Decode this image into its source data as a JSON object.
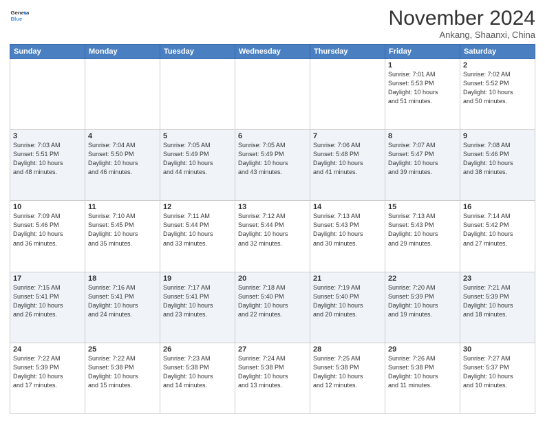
{
  "header": {
    "logo_line1": "General",
    "logo_line2": "Blue",
    "month": "November 2024",
    "location": "Ankang, Shaanxi, China"
  },
  "weekdays": [
    "Sunday",
    "Monday",
    "Tuesday",
    "Wednesday",
    "Thursday",
    "Friday",
    "Saturday"
  ],
  "weeks": [
    [
      {
        "day": "",
        "info": ""
      },
      {
        "day": "",
        "info": ""
      },
      {
        "day": "",
        "info": ""
      },
      {
        "day": "",
        "info": ""
      },
      {
        "day": "",
        "info": ""
      },
      {
        "day": "1",
        "info": "Sunrise: 7:01 AM\nSunset: 5:53 PM\nDaylight: 10 hours\nand 51 minutes."
      },
      {
        "day": "2",
        "info": "Sunrise: 7:02 AM\nSunset: 5:52 PM\nDaylight: 10 hours\nand 50 minutes."
      }
    ],
    [
      {
        "day": "3",
        "info": "Sunrise: 7:03 AM\nSunset: 5:51 PM\nDaylight: 10 hours\nand 48 minutes."
      },
      {
        "day": "4",
        "info": "Sunrise: 7:04 AM\nSunset: 5:50 PM\nDaylight: 10 hours\nand 46 minutes."
      },
      {
        "day": "5",
        "info": "Sunrise: 7:05 AM\nSunset: 5:49 PM\nDaylight: 10 hours\nand 44 minutes."
      },
      {
        "day": "6",
        "info": "Sunrise: 7:05 AM\nSunset: 5:49 PM\nDaylight: 10 hours\nand 43 minutes."
      },
      {
        "day": "7",
        "info": "Sunrise: 7:06 AM\nSunset: 5:48 PM\nDaylight: 10 hours\nand 41 minutes."
      },
      {
        "day": "8",
        "info": "Sunrise: 7:07 AM\nSunset: 5:47 PM\nDaylight: 10 hours\nand 39 minutes."
      },
      {
        "day": "9",
        "info": "Sunrise: 7:08 AM\nSunset: 5:46 PM\nDaylight: 10 hours\nand 38 minutes."
      }
    ],
    [
      {
        "day": "10",
        "info": "Sunrise: 7:09 AM\nSunset: 5:46 PM\nDaylight: 10 hours\nand 36 minutes."
      },
      {
        "day": "11",
        "info": "Sunrise: 7:10 AM\nSunset: 5:45 PM\nDaylight: 10 hours\nand 35 minutes."
      },
      {
        "day": "12",
        "info": "Sunrise: 7:11 AM\nSunset: 5:44 PM\nDaylight: 10 hours\nand 33 minutes."
      },
      {
        "day": "13",
        "info": "Sunrise: 7:12 AM\nSunset: 5:44 PM\nDaylight: 10 hours\nand 32 minutes."
      },
      {
        "day": "14",
        "info": "Sunrise: 7:13 AM\nSunset: 5:43 PM\nDaylight: 10 hours\nand 30 minutes."
      },
      {
        "day": "15",
        "info": "Sunrise: 7:13 AM\nSunset: 5:43 PM\nDaylight: 10 hours\nand 29 minutes."
      },
      {
        "day": "16",
        "info": "Sunrise: 7:14 AM\nSunset: 5:42 PM\nDaylight: 10 hours\nand 27 minutes."
      }
    ],
    [
      {
        "day": "17",
        "info": "Sunrise: 7:15 AM\nSunset: 5:41 PM\nDaylight: 10 hours\nand 26 minutes."
      },
      {
        "day": "18",
        "info": "Sunrise: 7:16 AM\nSunset: 5:41 PM\nDaylight: 10 hours\nand 24 minutes."
      },
      {
        "day": "19",
        "info": "Sunrise: 7:17 AM\nSunset: 5:41 PM\nDaylight: 10 hours\nand 23 minutes."
      },
      {
        "day": "20",
        "info": "Sunrise: 7:18 AM\nSunset: 5:40 PM\nDaylight: 10 hours\nand 22 minutes."
      },
      {
        "day": "21",
        "info": "Sunrise: 7:19 AM\nSunset: 5:40 PM\nDaylight: 10 hours\nand 20 minutes."
      },
      {
        "day": "22",
        "info": "Sunrise: 7:20 AM\nSunset: 5:39 PM\nDaylight: 10 hours\nand 19 minutes."
      },
      {
        "day": "23",
        "info": "Sunrise: 7:21 AM\nSunset: 5:39 PM\nDaylight: 10 hours\nand 18 minutes."
      }
    ],
    [
      {
        "day": "24",
        "info": "Sunrise: 7:22 AM\nSunset: 5:39 PM\nDaylight: 10 hours\nand 17 minutes."
      },
      {
        "day": "25",
        "info": "Sunrise: 7:22 AM\nSunset: 5:38 PM\nDaylight: 10 hours\nand 15 minutes."
      },
      {
        "day": "26",
        "info": "Sunrise: 7:23 AM\nSunset: 5:38 PM\nDaylight: 10 hours\nand 14 minutes."
      },
      {
        "day": "27",
        "info": "Sunrise: 7:24 AM\nSunset: 5:38 PM\nDaylight: 10 hours\nand 13 minutes."
      },
      {
        "day": "28",
        "info": "Sunrise: 7:25 AM\nSunset: 5:38 PM\nDaylight: 10 hours\nand 12 minutes."
      },
      {
        "day": "29",
        "info": "Sunrise: 7:26 AM\nSunset: 5:38 PM\nDaylight: 10 hours\nand 11 minutes."
      },
      {
        "day": "30",
        "info": "Sunrise: 7:27 AM\nSunset: 5:37 PM\nDaylight: 10 hours\nand 10 minutes."
      }
    ]
  ]
}
